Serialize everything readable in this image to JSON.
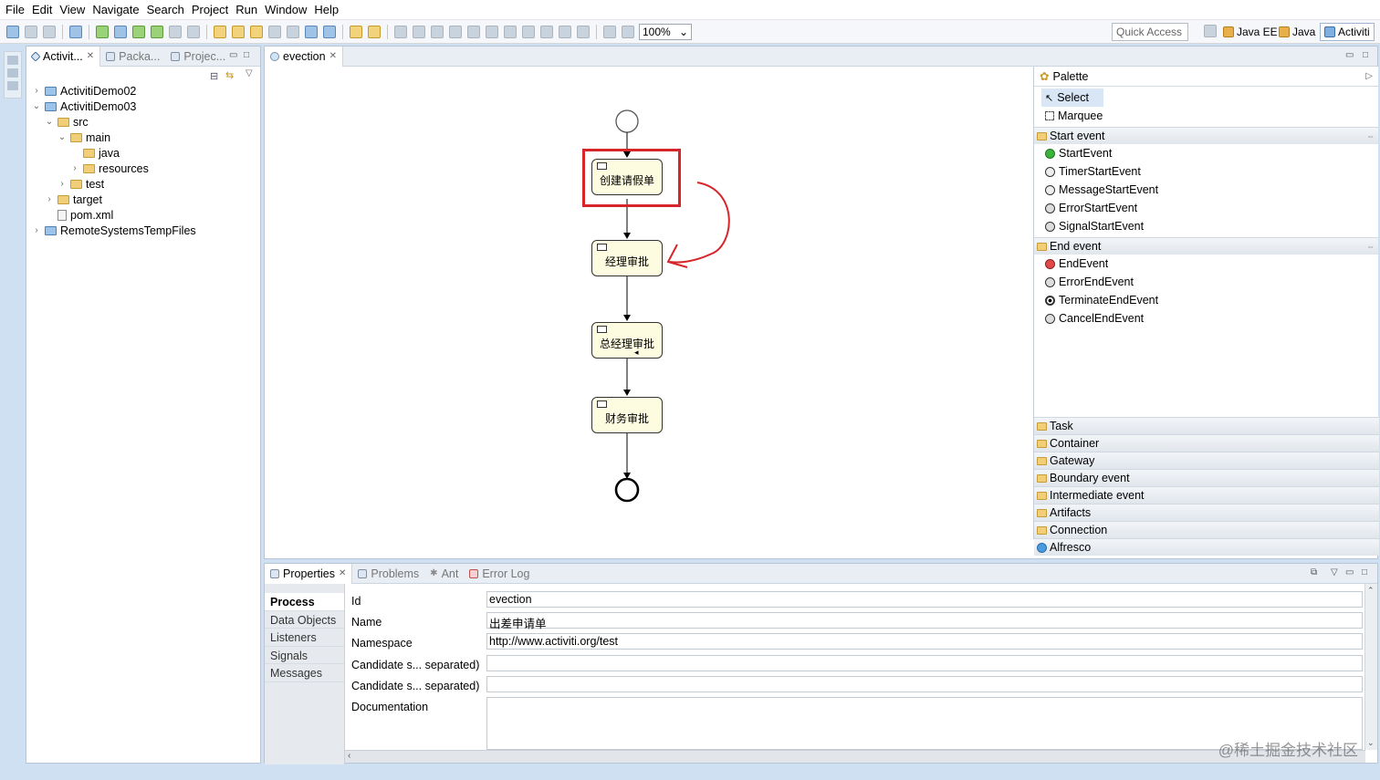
{
  "menu": [
    "File",
    "Edit",
    "View",
    "Navigate",
    "Search",
    "Project",
    "Run",
    "Window",
    "Help"
  ],
  "toolbar": {
    "zoom": "100%",
    "quick_access": "Quick Access"
  },
  "perspectives": [
    "Java EE",
    "Java",
    "Activiti"
  ],
  "explorer": {
    "tabs": [
      "Activit...",
      "Packa...",
      "Projec..."
    ],
    "tree": [
      {
        "label": "ActivitiDemo02"
      },
      {
        "label": "ActivitiDemo03"
      },
      {
        "label": "src"
      },
      {
        "label": "main"
      },
      {
        "label": "java"
      },
      {
        "label": "resources"
      },
      {
        "label": "test"
      },
      {
        "label": "target"
      },
      {
        "label": "pom.xml"
      },
      {
        "label": "RemoteSystemsTempFiles"
      }
    ]
  },
  "editor": {
    "tab": "evection",
    "tasks": [
      "创建请假单",
      "经理审批",
      "总经理审批",
      "财务审批"
    ]
  },
  "palette": {
    "title": "Palette",
    "tools": [
      "Select",
      "Marquee"
    ],
    "start_group": "Start event",
    "start_items": [
      "StartEvent",
      "TimerStartEvent",
      "MessageStartEvent",
      "ErrorStartEvent",
      "SignalStartEvent"
    ],
    "end_group": "End event",
    "end_items": [
      "EndEvent",
      "ErrorEndEvent",
      "TerminateEndEvent",
      "CancelEndEvent"
    ],
    "groups": [
      "Task",
      "Container",
      "Gateway",
      "Boundary event",
      "Intermediate event",
      "Artifacts",
      "Connection",
      "Alfresco"
    ]
  },
  "properties": {
    "tabs": [
      "Properties",
      "Problems",
      "Ant",
      "Error Log"
    ],
    "sections": [
      "Process",
      "Data Objects",
      "Listeners",
      "Signals",
      "Messages"
    ],
    "fields": [
      {
        "label": "Id",
        "value": "evection"
      },
      {
        "label": "Name",
        "value": "出差申请单"
      },
      {
        "label": "Namespace",
        "value": "http://www.activiti.org/test"
      },
      {
        "label": "Candidate s... separated)",
        "value": ""
      },
      {
        "label": "Candidate s... separated)",
        "value": ""
      },
      {
        "label": "Documentation",
        "value": ""
      }
    ]
  },
  "watermark": "@稀土掘金技术社区",
  "colors": {
    "highlight": "#d6262c",
    "task_fill": "#fdfbe0"
  }
}
